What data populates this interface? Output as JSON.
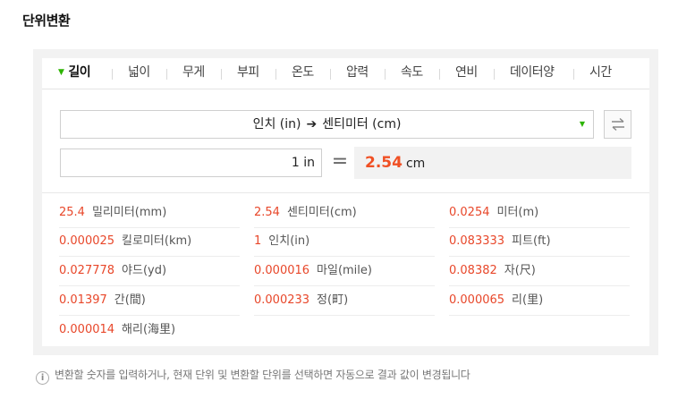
{
  "title": "단위변환",
  "tabs": [
    "길이",
    "넓이",
    "무게",
    "부피",
    "온도",
    "압력",
    "속도",
    "연비",
    "데이터양",
    "시간"
  ],
  "selector": {
    "from": "인치 (in)",
    "to": "센티미터 (cm)",
    "arrow_icon": "arrow-right-icon",
    "dropdown_icon": "triangle-down-icon"
  },
  "input": {
    "value": "1",
    "unit": "in"
  },
  "equals": "=",
  "result": {
    "value": "2.54",
    "unit": "cm"
  },
  "conversions": [
    {
      "value": "25.4",
      "unit": "밀리미터(mm)"
    },
    {
      "value": "2.54",
      "unit": "센티미터(cm)"
    },
    {
      "value": "0.0254",
      "unit": "미터(m)"
    },
    {
      "value": "0.000025",
      "unit": "킬로미터(km)"
    },
    {
      "value": "1",
      "unit": "인치(in)"
    },
    {
      "value": "0.083333",
      "unit": "피트(ft)"
    },
    {
      "value": "0.027778",
      "unit": "야드(yd)"
    },
    {
      "value": "0.000016",
      "unit": "마일(mile)"
    },
    {
      "value": "0.08382",
      "unit": "자(尺)"
    },
    {
      "value": "0.01397",
      "unit": "간(間)"
    },
    {
      "value": "0.000233",
      "unit": "정(町)"
    },
    {
      "value": "0.000065",
      "unit": "리(里)"
    },
    {
      "value": "0.000014",
      "unit": "해리(海里)"
    }
  ],
  "help": {
    "icon": "info-icon",
    "text": "변환할 숫자를 입력하거나, 현재 단위 및 변환할 단위를 선택하면 자동으로 결과 값이 변경됩니다"
  },
  "colors": {
    "accent_green": "#2db400",
    "result_red": "#f05024",
    "value_red": "#e8472a"
  }
}
